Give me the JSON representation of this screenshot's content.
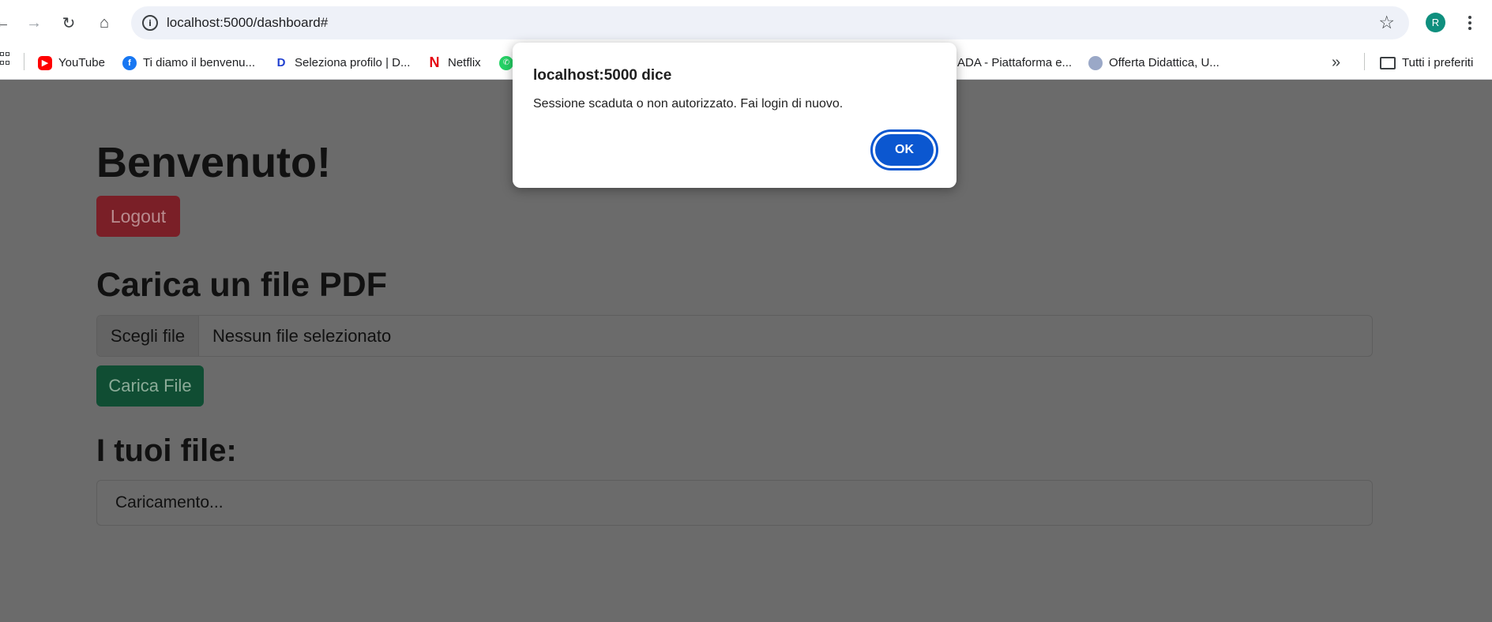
{
  "browser": {
    "url": "localhost:5000/dashboard#",
    "profile_initial": "R",
    "icons": {
      "back": "back-arrow-icon",
      "forward": "forward-arrow-icon",
      "reload": "reload-icon",
      "home": "home-icon",
      "site_info": "info-icon",
      "bookmark": "star-icon",
      "menu": "kebab-menu-icon"
    }
  },
  "bookmarks": {
    "items": [
      {
        "label": "YouTube",
        "icon": "youtube-icon",
        "color": "#ff0000"
      },
      {
        "label": "Ti diamo il benvenu...",
        "icon": "facebook-icon",
        "color": "#1877f2"
      },
      {
        "label": "Seleziona profilo | D...",
        "icon": "disney-icon",
        "color": "#1f3fcf"
      },
      {
        "label": "Netflix",
        "icon": "netflix-icon",
        "color": "#e50914"
      },
      {
        "label": "",
        "icon": "whatsapp-icon",
        "color": "#25d366"
      },
      {
        "label": "ADA - Piattaforma e...",
        "icon": "",
        "color": ""
      },
      {
        "label": "Offerta Didattica, U...",
        "icon": "university-icon",
        "color": "#9aa8c7"
      }
    ],
    "overflow_icon": "double-chevron-icon",
    "all_bookmarks": "Tutti i preferiti"
  },
  "page": {
    "welcome": "Benvenuto!",
    "logout": "Logout",
    "upload_heading": "Carica un file PDF",
    "file_button": "Scegli file",
    "file_status": "Nessun file selezionato",
    "upload_button": "Carica File",
    "files_heading": "I tuoi file:",
    "files_loading": "Caricamento...",
    "colors": {
      "logout": "#dc3545",
      "upload": "#198754",
      "overlay": "#6b6b6b"
    }
  },
  "dialog": {
    "title": "localhost:5000 dice",
    "message": "Sessione scaduta o non autorizzato. Fai login di nuovo.",
    "ok": "OK",
    "accent": "#0b57d0"
  }
}
